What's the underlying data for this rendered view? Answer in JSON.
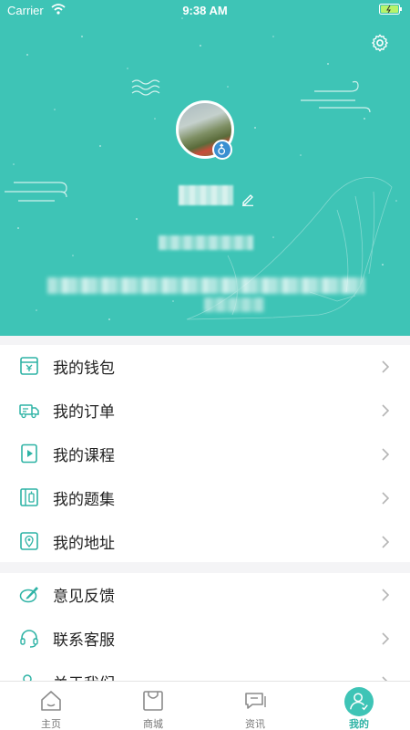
{
  "status_bar": {
    "carrier": "Carrier",
    "time": "9:38 AM"
  },
  "colors": {
    "accent": "#3ec4b6",
    "tab_active": "#2eb3a5",
    "icon": "#2eb3a5"
  },
  "profile": {
    "settings_icon": "gear-icon",
    "avatar": "avatar-photo",
    "gender_icon": "male-icon",
    "edit_icon": "pencil-icon"
  },
  "menu_group_1": [
    {
      "label": "我的钱包",
      "icon": "wallet-icon"
    },
    {
      "label": "我的订单",
      "icon": "order-truck-icon"
    },
    {
      "label": "我的课程",
      "icon": "course-play-icon"
    },
    {
      "label": "我的题集",
      "icon": "question-book-icon"
    },
    {
      "label": "我的地址",
      "icon": "location-pin-icon"
    }
  ],
  "menu_group_2": [
    {
      "label": "意见反馈",
      "icon": "feedback-pen-icon"
    },
    {
      "label": "联系客服",
      "icon": "headset-icon"
    },
    {
      "label": "关于我们",
      "icon": "about-users-icon"
    }
  ],
  "tabbar": [
    {
      "label": "主页",
      "icon": "home-icon",
      "active": false
    },
    {
      "label": "商城",
      "icon": "shop-bag-icon",
      "active": false
    },
    {
      "label": "资讯",
      "icon": "news-chat-icon",
      "active": false
    },
    {
      "label": "我的",
      "icon": "profile-icon",
      "active": true
    }
  ]
}
